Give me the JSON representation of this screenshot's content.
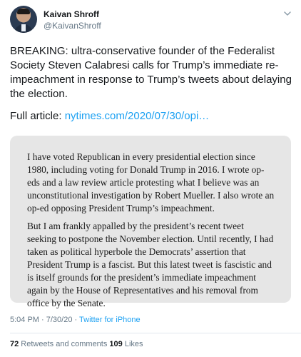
{
  "user": {
    "name": "Kaivan Shroff",
    "handle": "@KaivanShroff"
  },
  "tweet": {
    "text": "BREAKING: ultra-conservative founder of the Federalist Society Steven Calabresi calls for Trump’s immediate re-impeachment in response to Trump’s tweets about delaying the election.",
    "full_article_label": "Full article: ",
    "link": "nytimes.com/2020/07/30/opi…"
  },
  "quote": {
    "paragraphs": [
      "I have voted Republican in every presidential election since 1980, including voting for Donald Trump in 2016. I wrote op-eds and a law review article protesting what I believe was an unconstitutional investigation by Robert Mueller. I also wrote an op-ed opposing President Trump’s impeachment.",
      "But I am frankly appalled by the president’s recent tweet seeking to postpone the November election. Until recently, I had taken as political hyperbole the Democrats’ assertion that President Trump is a fascist. But this latest tweet is fascistic and is itself grounds for the president’s immediate impeachment again by the House of Representatives and his removal from office by the Senate."
    ]
  },
  "meta": {
    "time": "5:04 PM",
    "separator1": " · ",
    "date": "7/30/20",
    "separator2": " · ",
    "source": "Twitter for iPhone"
  },
  "stats": {
    "retweets_count": "72",
    "retweets_label": " Retweets and comments ",
    "likes_count": "109",
    "likes_label": " Likes"
  },
  "colors": {
    "link": "#1da1f2",
    "secondary_text": "#657786",
    "quote_background": "#e6e6e6"
  },
  "icons": {
    "more_menu": "chevron-down-icon"
  }
}
